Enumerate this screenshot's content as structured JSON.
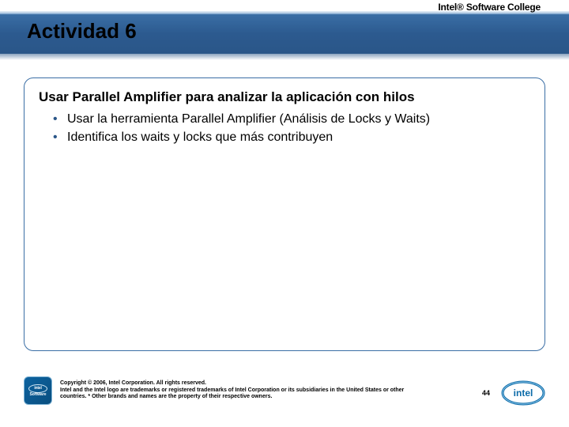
{
  "brand_top": "Intel® Software College",
  "title": "Actividad 6",
  "content": {
    "subheading": "Usar Parallel Amplifier para analizar la aplicación con hilos",
    "bullets": [
      "Usar la herramienta Parallel Amplifier (Análisis de Locks y Waits)",
      "Identifica los waits y locks que más contribuyen"
    ]
  },
  "footer": {
    "badge_top": "intel",
    "badge_bottom": "Software",
    "legal_line1": "Copyright © 2006, Intel Corporation. All rights reserved.",
    "legal_line2": "Intel and the Intel logo are trademarks or registered trademarks of Intel Corporation or its subsidiaries in the United States or other countries. * Other brands and names are the property of their respective owners.",
    "page_number": "44",
    "corner_logo_text": "intel"
  }
}
